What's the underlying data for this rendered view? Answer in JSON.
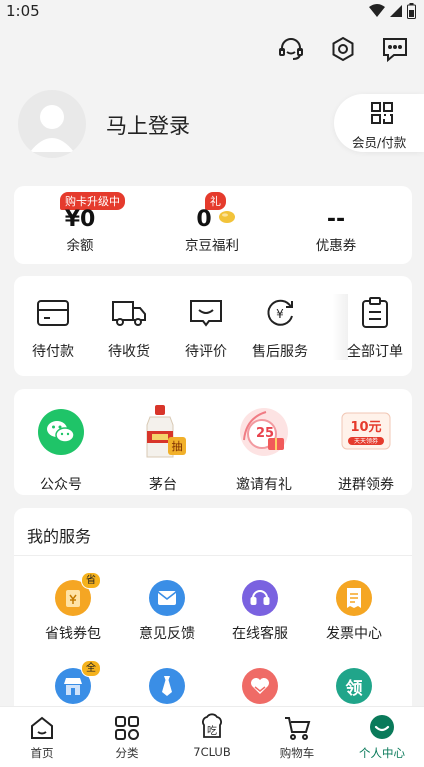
{
  "status_bar": {
    "time": "1:05"
  },
  "header": {
    "icons": [
      "customer-service-icon",
      "settings-icon",
      "message-icon"
    ]
  },
  "profile": {
    "login_text": "马上登录",
    "pay_label": "会员/付款"
  },
  "assets": [
    {
      "value": "¥0",
      "label": "余额",
      "badge": "购卡升级中"
    },
    {
      "value": "0",
      "label": "京豆福利",
      "badge": "礼"
    },
    {
      "value": "--",
      "label": "优惠券",
      "badge": ""
    }
  ],
  "orders": [
    {
      "label": "待付款",
      "icon": "wallet-icon"
    },
    {
      "label": "待收货",
      "icon": "truck-icon"
    },
    {
      "label": "待评价",
      "icon": "comment-icon"
    },
    {
      "label": "售后服务",
      "icon": "refund-icon"
    },
    {
      "label": "全部订单",
      "icon": "orders-list-icon"
    }
  ],
  "promos": [
    {
      "label": "公众号",
      "icon": "wechat-icon"
    },
    {
      "label": "茅台",
      "icon": "moutai-icon",
      "badge": "抽"
    },
    {
      "label": "邀请有礼",
      "icon": "invite-gift-icon",
      "badge": "25"
    },
    {
      "label": "进群领券",
      "icon": "group-coupon-icon",
      "badge": "10元",
      "sub": "天天领券"
    }
  ],
  "services": {
    "title": "我的服务",
    "items": [
      {
        "label": "省钱券包",
        "icon": "coupon-pack-icon",
        "tag": "省",
        "color": "#f5a623"
      },
      {
        "label": "意见反馈",
        "icon": "feedback-icon",
        "tag": "",
        "color": "#3a8ee6"
      },
      {
        "label": "在线客服",
        "icon": "headset-icon",
        "tag": "",
        "color": "#7a62e0"
      },
      {
        "label": "发票中心",
        "icon": "invoice-icon",
        "tag": "",
        "color": "#f5a623"
      },
      {
        "label": "",
        "icon": "store-icon",
        "tag": "全",
        "color": "#3a8ee6"
      },
      {
        "label": "",
        "icon": "tie-icon",
        "tag": "",
        "color": "#3a8ee6"
      },
      {
        "label": "",
        "icon": "heart-hands-icon",
        "tag": "",
        "color": "#ef6b66"
      },
      {
        "label": "",
        "icon": "claim-icon",
        "tag": "领",
        "color": "#20a58a"
      }
    ]
  },
  "tabbar": [
    {
      "label": "首页",
      "icon": "home-icon",
      "active": false
    },
    {
      "label": "分类",
      "icon": "category-icon",
      "active": false
    },
    {
      "label": "7CLUB",
      "icon": "seven-club-icon",
      "active": false
    },
    {
      "label": "购物车",
      "icon": "cart-icon",
      "active": false
    },
    {
      "label": "个人中心",
      "icon": "profile-icon",
      "active": true
    }
  ],
  "colors": {
    "accent": "#0a7a5a",
    "badge_red": "#e53b2d",
    "tag_yellow": "#f5b21d"
  }
}
